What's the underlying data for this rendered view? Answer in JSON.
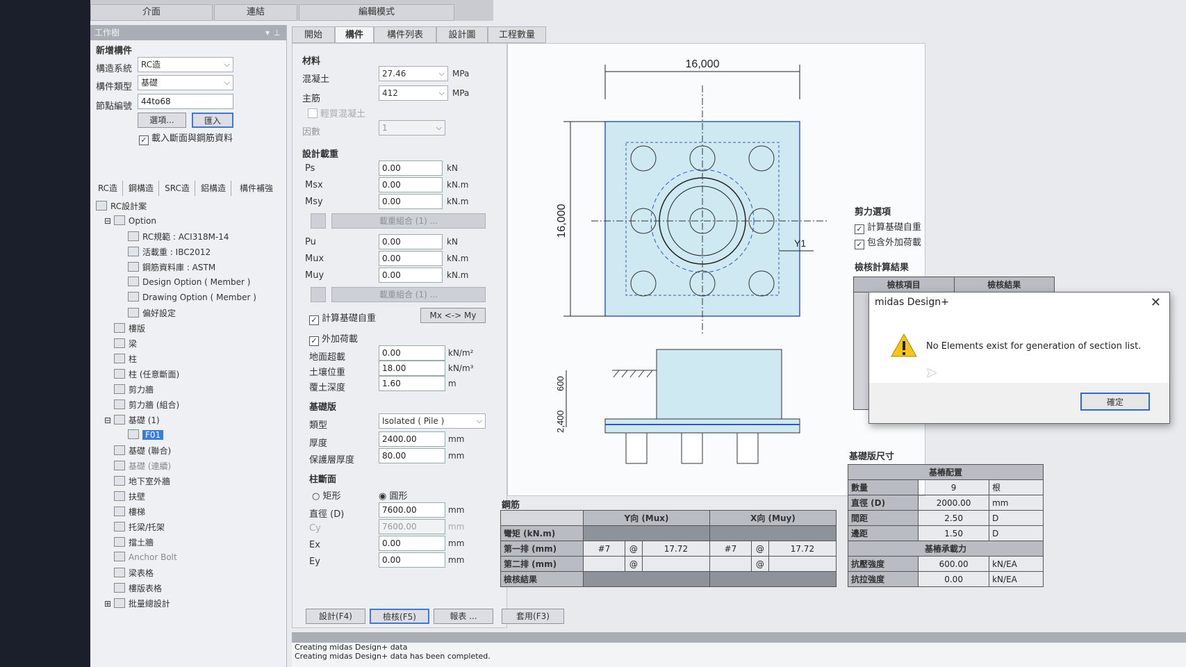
{
  "mode_tabs": [
    "介面",
    "連結",
    "編輯模式"
  ],
  "workspace_title": "工作樹",
  "new_member": {
    "title": "新增構件",
    "system_label": "構造系統",
    "system_value": "RC造",
    "type_label": "構件類型",
    "type_value": "基礎",
    "section_label": "節點編號",
    "section_value": "44to68",
    "option_button": "選項...",
    "import_button": "匯入",
    "load_checkbox": "載入斷面與鋼筋資料"
  },
  "struct_tabs": [
    "RC造",
    "鋼構造",
    "SRC造",
    "鋁構造",
    "構件補強"
  ],
  "tree": [
    {
      "label": "RC設計案",
      "level": 0
    },
    {
      "label": "Option",
      "level": 1
    },
    {
      "label": "RC規範 : ACI318M-14",
      "level": 2
    },
    {
      "label": "活載重 : IBC2012",
      "level": 2
    },
    {
      "label": "鋼筋資料庫 : ASTM",
      "level": 2
    },
    {
      "label": "Design Option ( Member )",
      "level": 2
    },
    {
      "label": "Drawing Option ( Member )",
      "level": 2
    },
    {
      "label": "偏好設定",
      "level": 2
    },
    {
      "label": "樓版",
      "level": 1
    },
    {
      "label": "梁",
      "level": 1
    },
    {
      "label": "柱",
      "level": 1
    },
    {
      "label": "柱 (任意斷面)",
      "level": 1
    },
    {
      "label": "剪力牆",
      "level": 1
    },
    {
      "label": "剪力牆 (組合)",
      "level": 1
    },
    {
      "label": "基礎 (1)",
      "level": 1
    },
    {
      "label": "F01",
      "level": 2
    },
    {
      "label": "基礎 (聯合)",
      "level": 1
    },
    {
      "label": "基礎 (連續)",
      "level": 1
    },
    {
      "label": "地下室外牆",
      "level": 1
    },
    {
      "label": "扶壁",
      "level": 1
    },
    {
      "label": "樓梯",
      "level": 1
    },
    {
      "label": "托梁/托架",
      "level": 1
    },
    {
      "label": "擋土牆",
      "level": 1
    },
    {
      "label": "Anchor Bolt",
      "level": 1
    },
    {
      "label": "梁表格",
      "level": 1
    },
    {
      "label": "樓版表格",
      "level": 1
    },
    {
      "label": "批量總設計",
      "level": 1
    }
  ],
  "main_tabs": [
    "開始",
    "構件",
    "構件列表",
    "設計圖",
    "工程數量"
  ],
  "material": {
    "title": "材料",
    "concrete_label": "混凝土",
    "concrete_value": "27.46",
    "rebar_label": "主筋",
    "rebar_value": "412",
    "unit_mpa": "MPa",
    "light_concrete": "輕質混凝土",
    "factor_label": "因數",
    "factor_value": "1"
  },
  "design_load": {
    "title": "設計載重",
    "ps_label": "Ps",
    "ps_value": "0.00",
    "ps_unit": "kN",
    "msx_label": "Msx",
    "msx_value": "0.00",
    "msx_unit": "kN.m",
    "msy_label": "Msy",
    "msy_value": "0.00",
    "msy_unit": "kN.m",
    "combo1": "載重組合 (1) ...",
    "pu_label": "Pu",
    "pu_value": "0.00",
    "pu_unit": "kN",
    "mux_label": "Mux",
    "mux_value": "0.00",
    "mux_unit": "kN.m",
    "muy_label": "Muy",
    "muy_value": "0.00",
    "muy_unit": "kN.m",
    "combo2": "載重組合 (1) ...",
    "self_weight": "計算基礎自重",
    "swap_button": "Mx <-> My",
    "external_load": "外加荷載",
    "surcharge_label": "地面超載",
    "surcharge_value": "0.00",
    "surcharge_unit": "kN/m²",
    "soil_label": "土壤位重",
    "soil_value": "18.00",
    "soil_unit": "kN/m³",
    "cover_label": "覆土深度",
    "cover_value": "1.60",
    "cover_unit": "m"
  },
  "footing": {
    "title": "基礎版",
    "type_label": "類型",
    "type_value": "Isolated ( Pile )",
    "thickness_label": "厚度",
    "thickness_value": "2400.00",
    "cover_label": "保護層厚度",
    "cover_value": "80.00",
    "unit_mm": "mm"
  },
  "column_section": {
    "title": "柱斷面",
    "rect": "矩形",
    "circle": "圓形",
    "dia_label": "直徑 (D)",
    "dia_value": "7600.00",
    "cy_label": "Cy",
    "cy_value": "7600.00",
    "ex_label": "Ex",
    "ex_value": "0.00",
    "ey_label": "Ey",
    "ey_value": "0.00",
    "unit_mm": "mm"
  },
  "bottom_buttons": [
    "設計(F4)",
    "檢核(F5)",
    "報表 ...",
    "套用(F3)"
  ],
  "drawing": {
    "dim_top": "16,000",
    "dim_left": "16,000",
    "label_y1": "Y1",
    "dim_side1": "2,400",
    "dim_side2": "600"
  },
  "rebar_table": {
    "title": "鋼筋",
    "col_y": "Y向 (Mux)",
    "col_x": "X向 (Muy)",
    "row_moment": "彎矩 (kN.m)",
    "row_first": "第一排 (mm)",
    "row_second": "第二排 (mm)",
    "row_check": "檢核結果",
    "y_bar": "#7",
    "y_at": "@",
    "y_spacing": "17.72",
    "x_bar": "#7",
    "x_at": "@",
    "x_spacing": "17.72",
    "y_at2": "@",
    "x_at2": "@"
  },
  "shear_options": {
    "title": "剪力選項",
    "self_weight": "計算基礎自重",
    "external": "包含外加荷載"
  },
  "check_results": {
    "title": "檢核計算結果",
    "col_item": "檢核項目",
    "col_result": "檢核結果"
  },
  "pile_size": {
    "title": "基礎版尺寸",
    "layout_header": "基樁配置",
    "rows": [
      {
        "label": "數量",
        "value": "9",
        "unit": "根"
      },
      {
        "label": "直徑 (D)",
        "value": "2000.00",
        "unit": "mm"
      },
      {
        "label": "間距",
        "value": "2.50",
        "unit": "D"
      },
      {
        "label": "邊距",
        "value": "1.50",
        "unit": "D"
      }
    ],
    "capacity_header": "基樁承載力",
    "cap_rows": [
      {
        "label": "抗壓強度",
        "value": "600.00",
        "unit": "kN/EA"
      },
      {
        "label": "抗拉強度",
        "value": "0.00",
        "unit": "kN/EA"
      }
    ]
  },
  "status": {
    "line1": "Creating midas Design+ data",
    "line2": "Creating midas Design+ data has been completed."
  },
  "dialog": {
    "title": "midas Design+",
    "message": "No Elements exist for generation of section list.",
    "ok": "確定"
  }
}
